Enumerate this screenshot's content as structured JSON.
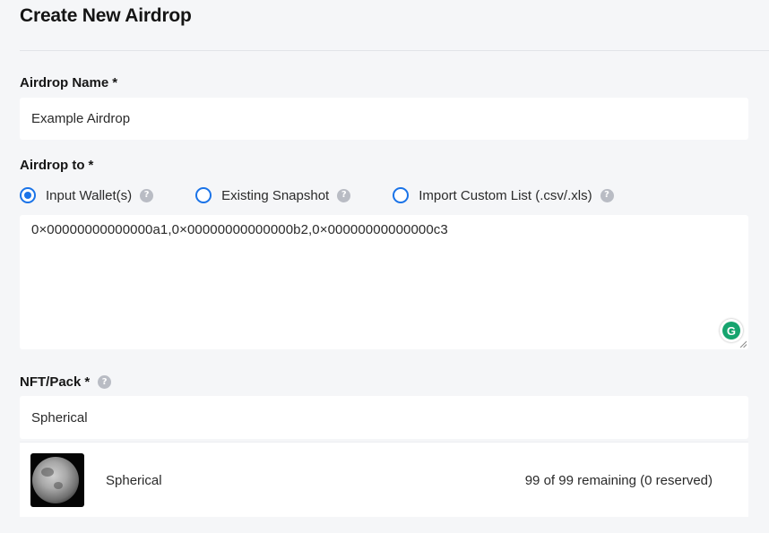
{
  "page": {
    "title": "Create New Airdrop"
  },
  "airdrop_name": {
    "label": "Airdrop Name",
    "required_mark": "*",
    "value": "Example Airdrop"
  },
  "airdrop_to": {
    "label": "Airdrop to",
    "required_mark": "*",
    "options": [
      {
        "label": "Input Wallet(s)",
        "selected": true
      },
      {
        "label": "Existing Snapshot",
        "selected": false
      },
      {
        "label": "Import Custom List (.csv/.xls)",
        "selected": false
      }
    ],
    "wallets_value": "0×00000000000000a1,0×00000000000000b2,0×00000000000000c3"
  },
  "help_glyph": "?",
  "grammarly_glyph": "G",
  "nft_pack": {
    "label": "NFT/Pack",
    "required_mark": "*",
    "value": "Spherical",
    "results": [
      {
        "name": "Spherical",
        "remaining": "99 of 99 remaining (0 reserved)",
        "thumbnail": "moon-image"
      }
    ]
  },
  "colors": {
    "accent": "#1a73e8",
    "help_icon": "#b9bcc4",
    "grammarly": "#15a46e",
    "background": "#f5f6f8"
  }
}
